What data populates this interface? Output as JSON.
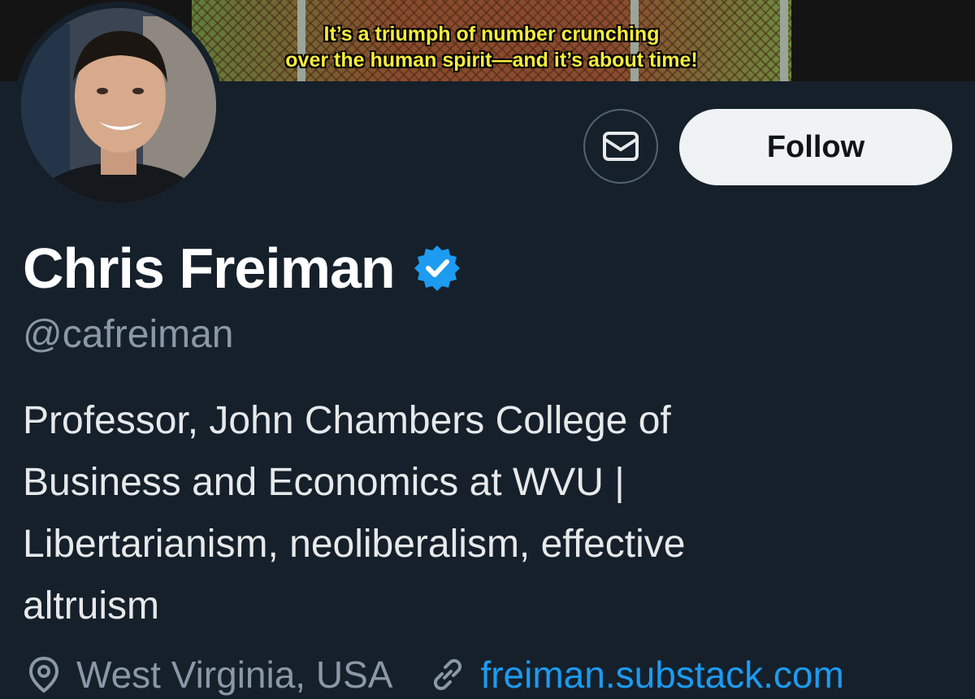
{
  "banner": {
    "caption_line1": "It’s a triumph of number crunching",
    "caption_line2": "over the human spirit—and it’s about time!"
  },
  "profile": {
    "display_name": "Chris Freiman",
    "handle": "@cafreiman",
    "verified": true,
    "bio_lines": [
      "Professor, John Chambers College of",
      "Business and Economics at WVU |",
      "Libertarianism, neoliberalism, effective",
      "altruism"
    ],
    "location": "West Virginia, USA",
    "website": "freiman.substack.com"
  },
  "actions": {
    "follow_label": "Follow"
  },
  "icons": {
    "message": "envelope-icon",
    "verified": "verified-badge-icon",
    "location": "location-pin-icon",
    "link": "link-icon"
  },
  "colors": {
    "background": "#15202b",
    "accent": "#1d9bf0",
    "secondary_text": "#8b98a5",
    "caption": "#f7ec3c"
  }
}
